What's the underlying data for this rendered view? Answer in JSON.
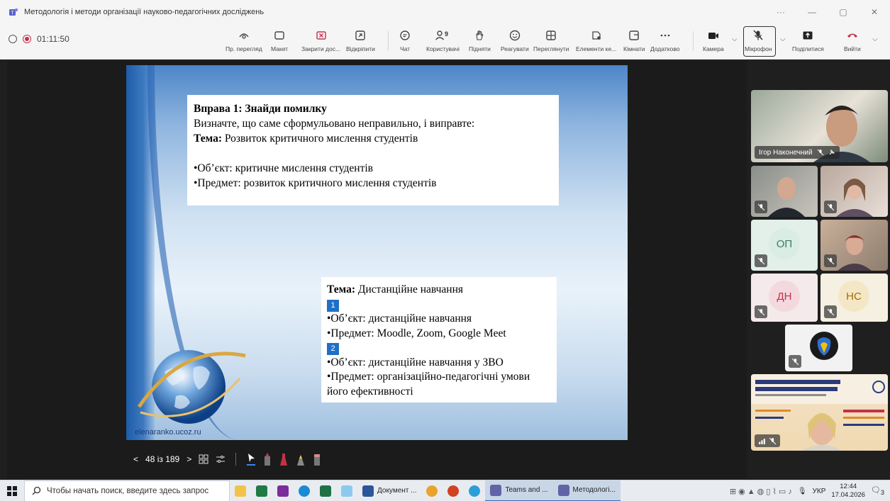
{
  "window": {
    "title": "Методологія і методи організації науково-педагогічних досліджень",
    "controls": [
      "···",
      "—",
      "▢",
      "✕"
    ]
  },
  "meeting": {
    "timer": "01:11:50",
    "toolbar": [
      {
        "id": "view",
        "label": "Пр. перегляд",
        "icon": "eye-icon"
      },
      {
        "id": "layout",
        "label": "Макет",
        "icon": "layout-icon"
      },
      {
        "id": "stop-share",
        "label": "Закрити дос...",
        "icon": "close-box-icon"
      },
      {
        "id": "unpin",
        "label": "Відкріпити",
        "icon": "unpin-icon"
      },
      {
        "id": "chat",
        "label": "Чат",
        "icon": "chat-icon"
      },
      {
        "id": "people",
        "label": "Користувачі",
        "icon": "people-icon",
        "badge": "9"
      },
      {
        "id": "raise",
        "label": "Підняти",
        "icon": "hand-icon"
      },
      {
        "id": "react",
        "label": "Реагувати",
        "icon": "smile-icon"
      },
      {
        "id": "view-all",
        "label": "Переглянути",
        "icon": "grid-icon"
      },
      {
        "id": "apps",
        "label": "Елементи ке...",
        "icon": "apps-icon"
      },
      {
        "id": "rooms",
        "label": "Кімнати",
        "icon": "rooms-icon"
      },
      {
        "id": "more",
        "label": "Додатково",
        "icon": "more-icon"
      },
      {
        "id": "camera",
        "label": "Камера",
        "icon": "camera-icon"
      },
      {
        "id": "mic",
        "label": "Мікрофон",
        "icon": "mic-off-icon"
      },
      {
        "id": "share",
        "label": "Поділитися",
        "icon": "share-icon"
      },
      {
        "id": "leave",
        "label": "Вийти",
        "icon": "phone-hangup-icon"
      }
    ]
  },
  "slide": {
    "box1": {
      "heading": "Вправа 1: Знайди помилку",
      "line1": "Визначте, що саме сформульовано неправильно, і виправте:",
      "topic_label": "Тема:",
      "topic_text": " Розвиток критичного мислення студентів",
      "object": "•Об’єкт: критичне мислення студентів",
      "subject": "•Предмет: розвиток критичного мислення студентів"
    },
    "box2": {
      "topic_label": "Тема:",
      "topic_text": " Дистанційне навчання",
      "n1": "1",
      "object1": "•Об’єкт: дистанційне навчання",
      "subject1": "•Предмет: Moodle, Zoom, Google Meet",
      "n2": "2",
      "object2": "•Об’єкт: дистанційне навчання у ЗВО",
      "subject2": "•Предмет: організаційно-педагогічні умови його ефективності"
    },
    "watermark": "elenaranko.ucoz.ru"
  },
  "presenter": {
    "page": "48 із 189"
  },
  "participants": [
    {
      "name": "Ігор Наконечний"
    },
    {
      "initials": "ОП",
      "color": "#4f7f7f",
      "bg": "#e3efe9"
    },
    {
      "initials": "ДН",
      "color": "#c4314b",
      "bg": "#f7e6e8"
    },
    {
      "initials": "НС",
      "color": "#a86b00",
      "bg": "#f6efdc"
    }
  ],
  "taskbar": {
    "search_placeholder": "Чтобы начать поиск, введите здесь запрос",
    "apps": [
      {
        "label": "Документ ...",
        "color": "#2b579a"
      },
      {
        "label": "Teams and ...",
        "color": "#6264a7"
      },
      {
        "label": "Методологі...",
        "color": "#6264a7"
      }
    ],
    "lang": "УКР",
    "time": "12:44",
    "date": "17.04.2026",
    "notif": "3"
  }
}
